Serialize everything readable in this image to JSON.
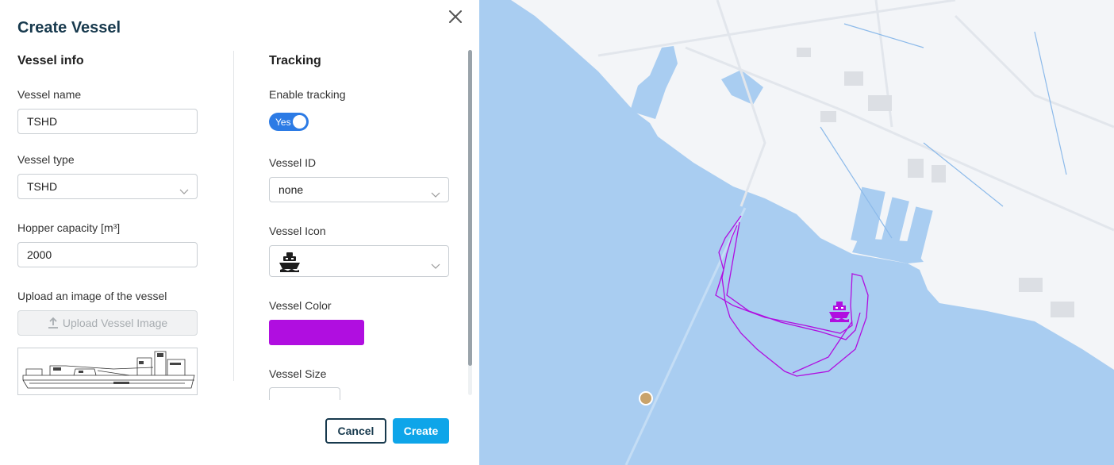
{
  "dialog": {
    "title": "Create Vessel",
    "cancel_label": "Cancel",
    "create_label": "Create"
  },
  "vessel_info": {
    "heading": "Vessel info",
    "name_label": "Vessel name",
    "name_value": "TSHD",
    "type_label": "Vessel type",
    "type_value": "TSHD",
    "hopper_label": "Hopper capacity [m³]",
    "hopper_value": "2000",
    "upload_label": "Upload an image of the vessel",
    "upload_button": "Upload Vessel Image"
  },
  "tracking": {
    "heading": "Tracking",
    "enable_label": "Enable tracking",
    "enable_value": "Yes",
    "vessel_id_label": "Vessel ID",
    "vessel_id_value": "none",
    "icon_label": "Vessel Icon",
    "icon_value": "ship-icon",
    "color_label": "Vessel Color",
    "color_value": "#b00ee0",
    "size_label": "Vessel Size"
  },
  "map": {
    "water_color": "#a9cdf1",
    "land_color": "#f3f5f8",
    "track_color": "#b00ee0",
    "marker_color": "#c9a36b"
  }
}
